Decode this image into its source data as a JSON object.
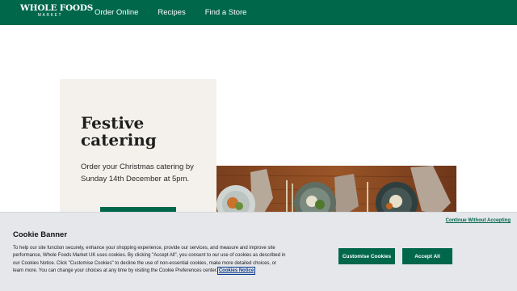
{
  "header": {
    "logo_main": "WHOLE FOODS",
    "logo_sub": "MARKET",
    "nav": [
      "Order Online",
      "Recipes",
      "Find a Store"
    ]
  },
  "hero": {
    "title": "Festive catering",
    "body": "Order your Christmas catering by Sunday 14th December at 5pm."
  },
  "cookie_banner": {
    "continue_label": "Continue Without Accepting",
    "title": "Cookie Banner",
    "text": "To help our site function securely, enhance your shopping experience, provide our services, and measure and improve site performance, Whole Foods Market UK uses cookies. By clicking \"Accept All\", you consent to our use of cookies as described in our Cookies Notice. Click \"Customise Cookies\" to decline the use of non-essential cookies, make more detailed choices, or learn more. You can change your choices at any time by visiting the Cookie Preferences center.",
    "notice_link": "Cookies Notice",
    "customise_label": "Customise Cookies",
    "accept_label": "Accept All"
  },
  "colors": {
    "brand_green": "#00674b",
    "banner_bg": "#e5e7ea",
    "card_bg": "#f4f1ec"
  },
  "icons": [
    "whole-foods-logo"
  ]
}
